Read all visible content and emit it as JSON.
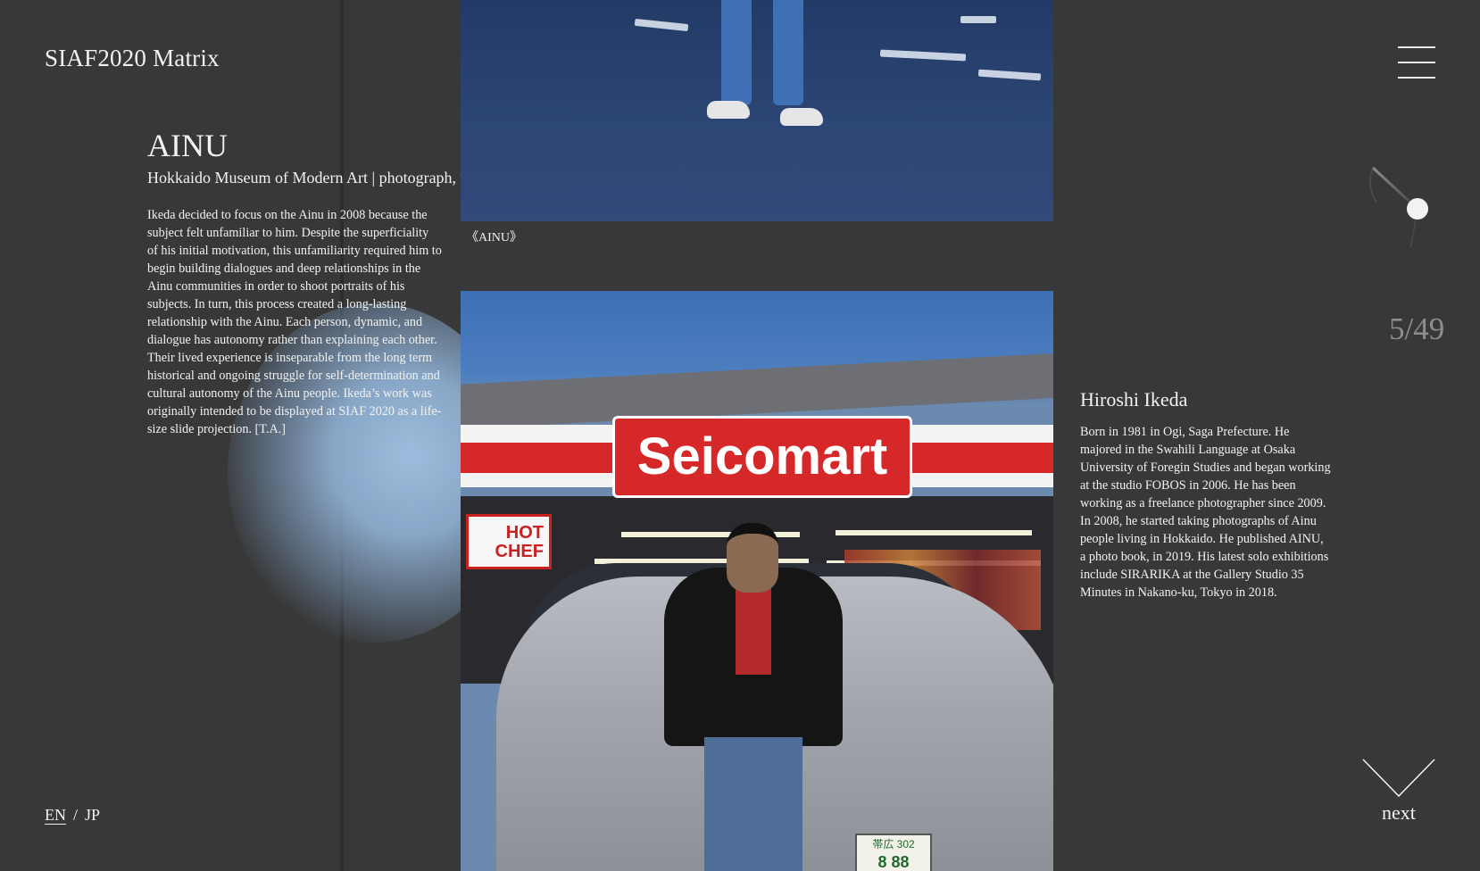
{
  "site": {
    "title": "SIAF2020 Matrix"
  },
  "menu": {
    "icon": "hamburger-menu-icon"
  },
  "work": {
    "title": "AINU",
    "subtitle": "Hokkaido Museum of Modern Art | photograph, video",
    "description": "Ikeda decided to focus on the Ainu in 2008 because the subject felt unfamiliar to him. Despite the superficiality of his initial motivation, this unfamiliarity required him to begin building dialogues and deep relationships in the Ainu communities in order to shoot portraits of his subjects. In turn, this process created a long-lasting relationship with the Ainu. Each person, dynamic, and dialogue has autonomy rather than explaining each other. Their lived experience is inseparable from the long term historical and ongoing struggle for self-determination and cultural autonomy of the Ainu people. Ikeda’s work was originally intended to be displayed at SIAF 2020 as a life-size slide projection. [T.A.]",
    "caption": "《AINU》"
  },
  "photo": {
    "sign_text": "Seicomart",
    "hot_chef": [
      "HOT",
      "CHEF"
    ],
    "plate": [
      "帯広 302",
      "8 88"
    ]
  },
  "artist": {
    "name": "Hiroshi Ikeda",
    "bio": "Born in 1981 in Ogi, Saga Prefecture. He majored in the Swahili Language at Osaka University of Foregin Studies and began working at the studio FOBOS in 2006. He has been working as a freelance photographer since 2009. In 2008, he started taking photographs of Ainu people living in Hokkaido. He published AINU, a photo book, in 2019. His latest solo exhibitions include SIRARIKA at the Gallery Studio 35 Minutes in Nakano-ku, Tokyo in 2018."
  },
  "pager": {
    "current": "5",
    "total": "49",
    "display": "5/49"
  },
  "navigation": {
    "next_label": "next",
    "next_icon": "chevron-down-icon"
  },
  "language": {
    "en": "EN",
    "separator": "/",
    "jp": "JP",
    "active": "EN"
  },
  "colors": {
    "background": "#383838",
    "text": "#f2f2f2",
    "glow": "#a2c4e6",
    "counter": "#8d8d8d"
  }
}
